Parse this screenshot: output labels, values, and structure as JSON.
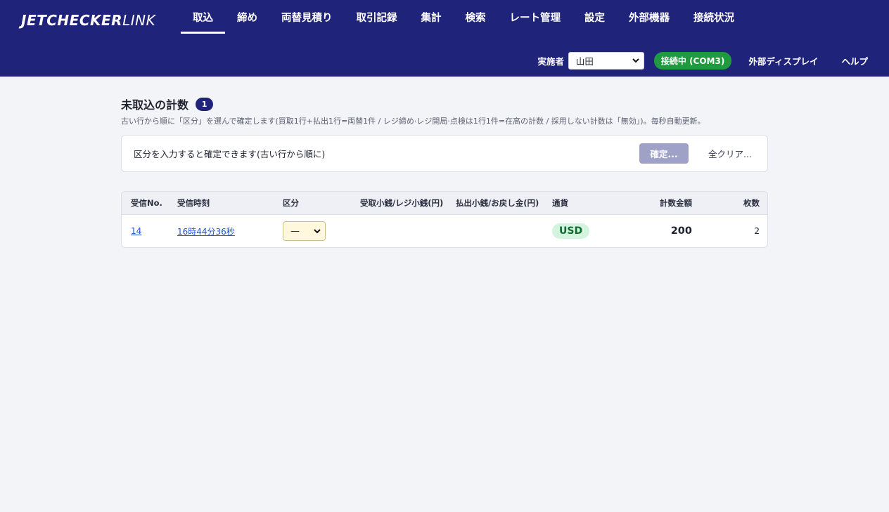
{
  "app": {
    "logo_bold": "JETCHECKER",
    "logo_light": "LINK"
  },
  "nav": [
    {
      "label": "取込",
      "active": true
    },
    {
      "label": "締め"
    },
    {
      "label": "両替見積り"
    },
    {
      "label": "取引記録"
    },
    {
      "label": "集計"
    },
    {
      "label": "検索"
    },
    {
      "label": "レート管理"
    },
    {
      "label": "設定"
    },
    {
      "label": "外部機器"
    },
    {
      "label": "接続状況"
    }
  ],
  "subbar": {
    "operator_label": "実施者",
    "operator_value": "山田",
    "connection": "接続中 (COM3)",
    "external_display": "外部ディスプレイ",
    "help": "ヘルプ"
  },
  "page": {
    "title": "未取込の計数",
    "count": "1",
    "subtitle": "古い行から順に「区分」を選んで確定します(買取1行+払出1行=両替1件 / レジ締め·レジ開局·点検は1行1件=在高の計数 / 採用しない計数は「無効」)。毎秒自動更新。"
  },
  "confirm_panel": {
    "text": "区分を入力すると確定できます(古い行から順に)",
    "confirm_label": "確定...",
    "clear_label": "全クリア..."
  },
  "table": {
    "headers": {
      "no": "受信No.",
      "time": "受信時刻",
      "category": "区分",
      "received_change": "受取小銭/レジ小銭(円)",
      "paid_change": "払出小銭/お戻し金(円)",
      "currency": "通貨",
      "amount": "計数金額",
      "count": "枚数"
    },
    "rows": [
      {
        "no": "14",
        "time": "16時44分36秒",
        "category": "—",
        "received_change": "",
        "paid_change": "",
        "currency": "USD",
        "amount": "200",
        "count": "2"
      }
    ]
  },
  "colors": {
    "topbar": "#1f237a",
    "accent_green": "#1f9a3f",
    "background": "#f3f4f8"
  }
}
